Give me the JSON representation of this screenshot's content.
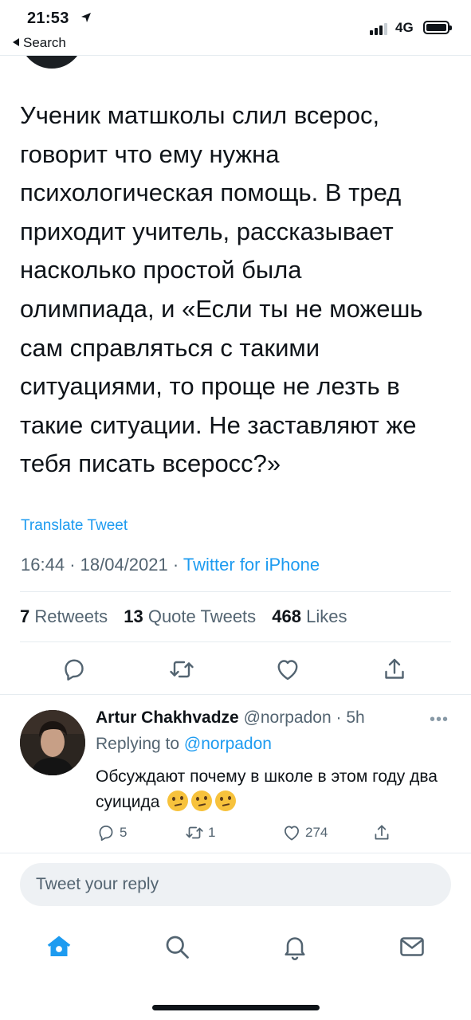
{
  "status_bar": {
    "time": "21:53",
    "back_label": "Search",
    "network": "4G"
  },
  "tweet": {
    "text_lines": [
      "Ученик матшколы слил всерос,",
      "говорит что ему нужна",
      "психологическая помощь. В тред",
      "приходит учитель, рассказывает",
      "насколько простой была",
      "олимпиада, и «Если ты не можешь",
      "сам справляться с такими",
      "ситуациями, то проще не лезть в",
      "такие ситуации. Не заставляют же",
      "тебя писать всеросс?»"
    ],
    "translate_label": "Translate Tweet",
    "time": "16:44",
    "date": "18/04/2021",
    "client": "Twitter for iPhone",
    "retweets_count": "7",
    "retweets_label": "Retweets",
    "quotes_count": "13",
    "quotes_label": "Quote Tweets",
    "likes_count": "468",
    "likes_label": "Likes"
  },
  "reply": {
    "name": "Artur Chakhvadze",
    "handle": "@norpadon",
    "age": "5h",
    "replying_prefix": "Replying to",
    "replying_to": "@norpadon",
    "text": "Обсуждают почему в школе в этом году два суицида",
    "emoji": "🤔",
    "reply_count": "5",
    "retweet_count": "1",
    "like_count": "274"
  },
  "compose": {
    "placeholder": "Tweet your reply"
  },
  "tabs": [
    "home-icon",
    "search-icon",
    "notifications-icon",
    "messages-icon"
  ],
  "colors": {
    "accent": "#1d9bf0",
    "text": "#0f1419",
    "secondary": "#536471",
    "divider": "#e6ecf0"
  }
}
